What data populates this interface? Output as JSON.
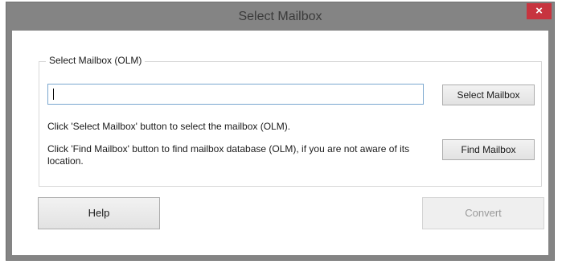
{
  "window": {
    "title": "Select Mailbox",
    "close_label": "×"
  },
  "group": {
    "legend": "Select Mailbox (OLM)",
    "input_value": "",
    "select_button_label": "Select Mailbox",
    "find_button_label": "Find Mailbox",
    "hint_select": "Click 'Select Mailbox' button to select the mailbox (OLM).",
    "hint_find": "Click 'Find Mailbox' button to find mailbox database (OLM), if you are not aware of its location."
  },
  "footer": {
    "help_label": "Help",
    "convert_label": "Convert"
  },
  "colors": {
    "title_bar": "#848484",
    "close_button": "#c7343f",
    "input_border": "#7aa7cf"
  },
  "state": {
    "convert_disabled": true
  }
}
